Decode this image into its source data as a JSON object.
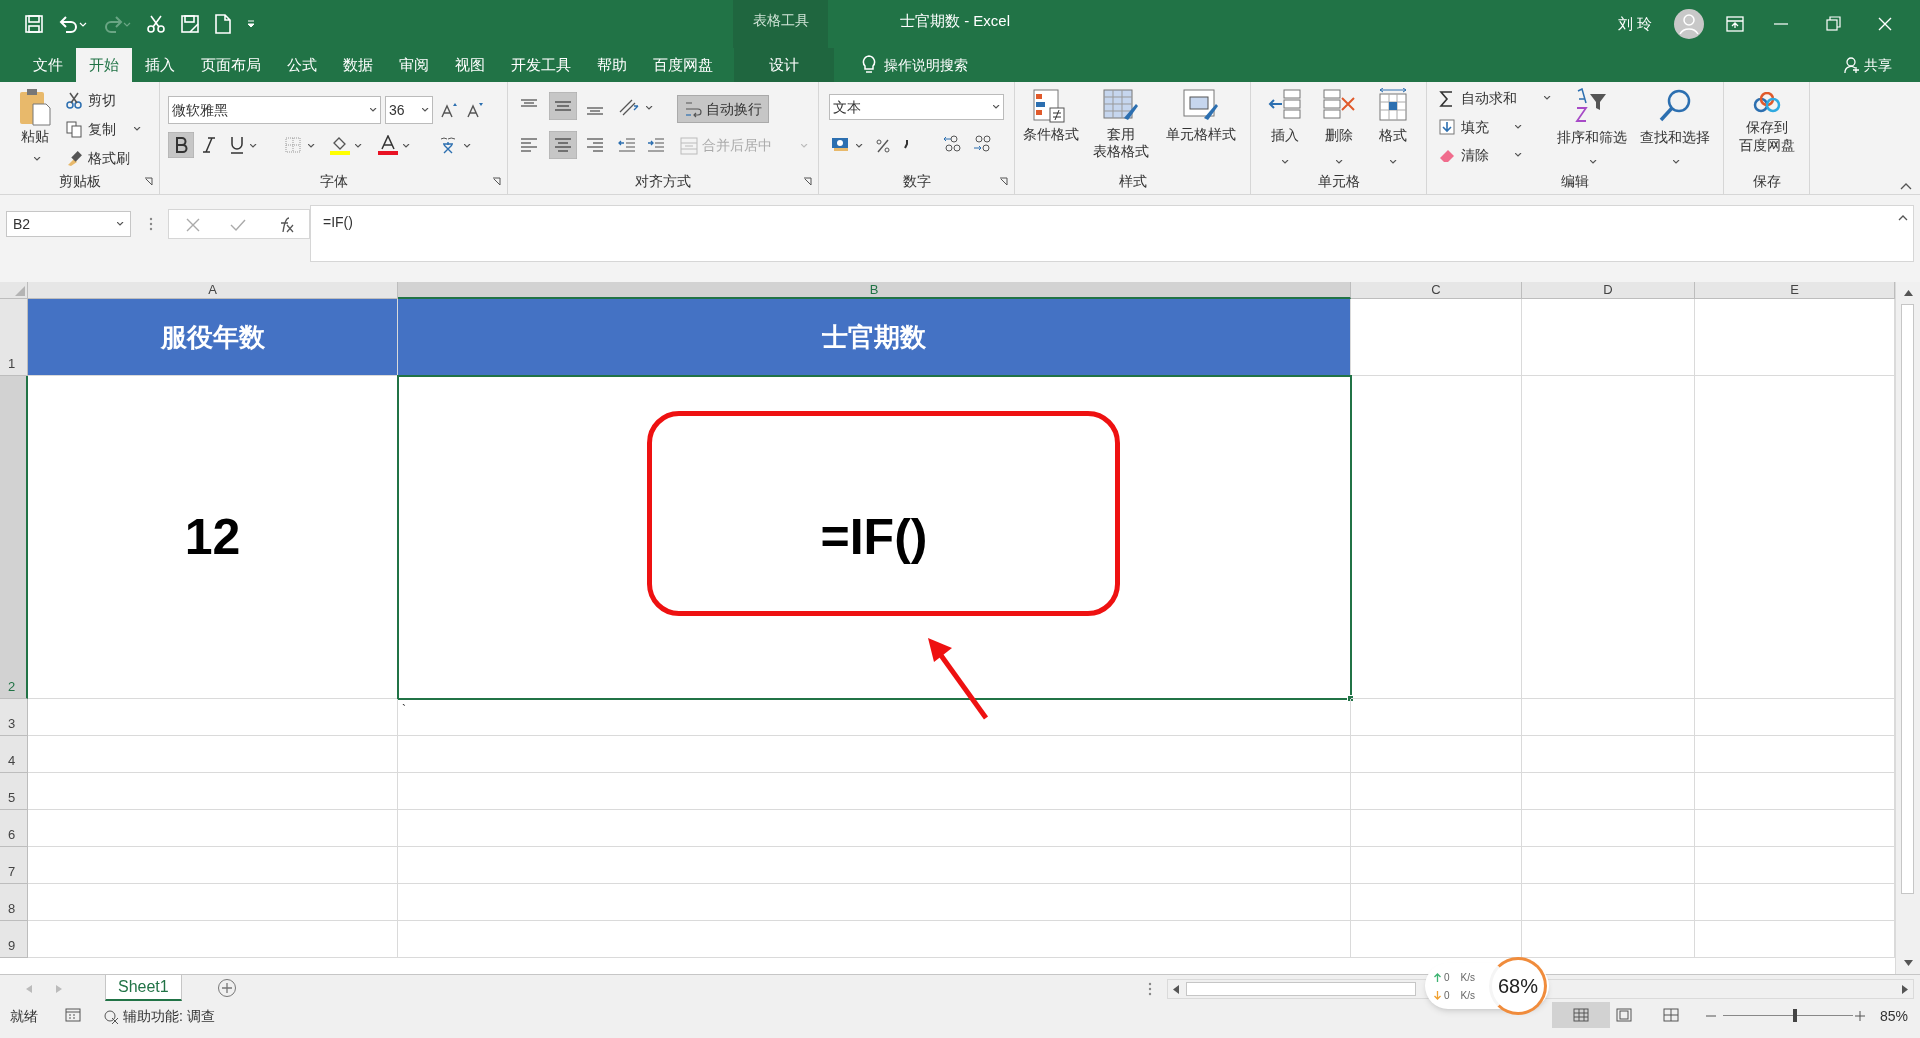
{
  "title_bar": {
    "context_label": "表格工具",
    "title": "士官期数  -  Excel",
    "user": "刘 玲"
  },
  "menu_tabs": [
    {
      "label": "文件",
      "selected": false
    },
    {
      "label": "开始",
      "selected": true
    },
    {
      "label": "插入",
      "selected": false
    },
    {
      "label": "页面布局",
      "selected": false
    },
    {
      "label": "公式",
      "selected": false
    },
    {
      "label": "数据",
      "selected": false
    },
    {
      "label": "审阅",
      "selected": false
    },
    {
      "label": "视图",
      "selected": false
    },
    {
      "label": "开发工具",
      "selected": false
    },
    {
      "label": "帮助",
      "selected": false
    },
    {
      "label": "百度网盘",
      "selected": false
    },
    {
      "label": "设计",
      "selected": false
    }
  ],
  "tell_me": "操作说明搜索",
  "share": "共享",
  "ribbon": {
    "clipboard": {
      "paste": "粘贴",
      "cut": "剪切",
      "copy": "复制",
      "painter": "格式刷",
      "label": "剪贴板"
    },
    "font": {
      "name": "微软雅黑",
      "size": "36",
      "label": "字体"
    },
    "alignment": {
      "wrap": "自动换行",
      "merge": "合并后居中",
      "label": "对齐方式"
    },
    "number": {
      "format": "文本",
      "label": "数字"
    },
    "styles": {
      "buttons": [
        {
          "lines": [
            "条件格式"
          ]
        },
        {
          "lines": [
            "套用",
            "表格格式"
          ]
        },
        {
          "lines": [
            "单元格样式"
          ]
        }
      ],
      "label": "样式"
    },
    "cells": {
      "buttons": [
        "插入",
        "删除",
        "格式"
      ],
      "label": "单元格"
    },
    "editing": {
      "autosum": "自动求和",
      "fill": "填充",
      "clear": "清除",
      "sort": "排序和筛选",
      "find": "查找和选择",
      "label": "编辑"
    },
    "save": {
      "lines": [
        "保存到",
        "百度网盘"
      ],
      "label": "保存"
    }
  },
  "formula_bar": {
    "name_box": "B2",
    "formula": "=IF()"
  },
  "columns": [
    {
      "label": "A",
      "selected": false
    },
    {
      "label": "B",
      "selected": true
    },
    {
      "label": "C",
      "selected": false
    },
    {
      "label": "D",
      "selected": false
    },
    {
      "label": "E",
      "selected": false
    }
  ],
  "rows": [
    {
      "label": "1",
      "selected": false,
      "cells": [
        {
          "text": "服役年数",
          "kind": "header"
        },
        {
          "text": "士官期数",
          "kind": "header"
        }
      ]
    },
    {
      "label": "2",
      "selected": true,
      "cells": [
        {
          "text": "12",
          "kind": "value"
        },
        {
          "text": "=IF()",
          "kind": "value",
          "selected": true
        }
      ]
    },
    {
      "label": "3",
      "selected": false,
      "cells": [
        {
          "kind": "empty"
        },
        {
          "text": "`",
          "kind": "mark"
        }
      ]
    },
    {
      "label": "4",
      "selected": false
    },
    {
      "label": "5",
      "selected": false
    },
    {
      "label": "6",
      "selected": false
    },
    {
      "label": "7",
      "selected": false
    },
    {
      "label": "8",
      "selected": false
    },
    {
      "label": "9",
      "selected": false
    }
  ],
  "sheet_tabs": [
    {
      "label": "Sheet1",
      "selected": true
    }
  ],
  "status_bar": {
    "ready": "就绪",
    "accessibility": "辅助功能: 调查",
    "zoom": "85%",
    "zoom_slider": {
      "level": 0.55
    }
  },
  "net_widget": {
    "up": "0",
    "up_unit": "K/s",
    "down": "0",
    "down_unit": "K/s",
    "percent": "68%"
  }
}
